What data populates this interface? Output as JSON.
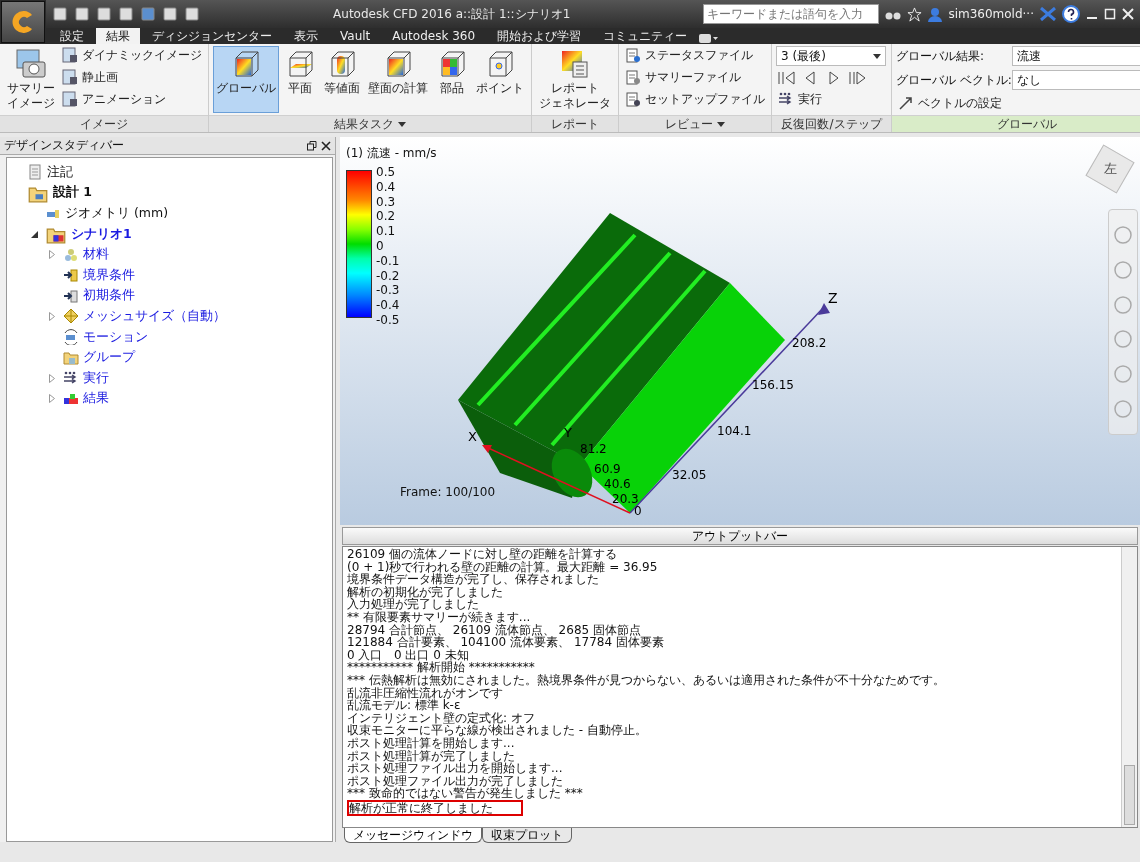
{
  "title_bar": {
    "title": "Autodesk CFD 2016   a::設計 1::シナリオ1",
    "search": {
      "placeholder": "キーワードまたは語句を入力"
    },
    "user": "sim360mold···"
  },
  "menu_tabs": [
    {
      "label": "設定",
      "selected": false
    },
    {
      "label": "結果",
      "selected": true
    },
    {
      "label": "ディシジョンセンター",
      "selected": false
    },
    {
      "label": "表示",
      "selected": false
    },
    {
      "label": "Vault",
      "selected": false
    },
    {
      "label": "Autodesk 360",
      "selected": false
    },
    {
      "label": "開始および学習",
      "selected": false
    },
    {
      "label": "コミュニティー",
      "selected": false
    }
  ],
  "ribbon": {
    "image_group": {
      "title": "イメージ",
      "big_button": [
        "サマリー",
        "イメージ"
      ],
      "small_buttons": [
        "ダイナミックイメージ",
        "静止画",
        "アニメーション"
      ]
    },
    "results_group": {
      "title": "結果タスク",
      "tools": [
        {
          "label": "グローバル",
          "selected": true
        },
        {
          "label": "平面",
          "selected": false
        },
        {
          "label": "等値面",
          "selected": false
        },
        {
          "label": "壁面の計算",
          "selected": false
        },
        {
          "label": "部品",
          "selected": false
        },
        {
          "label": "ポイント",
          "selected": false
        }
      ]
    },
    "report_group": {
      "title": "レポート",
      "button": [
        "レポート",
        "ジェネレータ"
      ]
    },
    "review_group": {
      "title": "レビュー",
      "items": [
        "ステータスファイル",
        "サマリーファイル",
        "セットアップファイル"
      ]
    },
    "iteration_group": {
      "title": "反復回数/ステップ",
      "step": "3 (最後)",
      "run": "実行"
    },
    "global_group": {
      "title": "グローバル",
      "rows": [
        {
          "label": "グローバル結果:",
          "value": "流速"
        },
        {
          "label": "グローバル ベクトル:",
          "value": "なし"
        }
      ],
      "vector_button": "ベクトルの設定"
    }
  },
  "design_bar": {
    "title": "デザインスタディバー",
    "tree": [
      {
        "label": "注記",
        "kind": "note"
      },
      {
        "label": "設計 1",
        "kind": "design",
        "children": [
          {
            "label": "ジオメトリ (mm)",
            "kind": "geometry"
          },
          {
            "label": "シナリオ1",
            "kind": "scenario",
            "expanded": true,
            "children": [
              {
                "label": "材料",
                "kind": "material",
                "expanded": false
              },
              {
                "label": "境界条件",
                "kind": "boundary"
              },
              {
                "label": "初期条件",
                "kind": "initial"
              },
              {
                "label": "メッシュサイズ（自動）",
                "kind": "mesh",
                "expanded": false
              },
              {
                "label": "モーション",
                "kind": "motion"
              },
              {
                "label": "グループ",
                "kind": "group"
              },
              {
                "label": "実行",
                "kind": "run",
                "expanded": false
              },
              {
                "label": "結果",
                "kind": "results",
                "expanded": false
              }
            ]
          }
        ]
      }
    ]
  },
  "viewport": {
    "result_title": "(1) 流速 - mm/s",
    "legend": [
      "0.5",
      "0.4",
      "0.3",
      "0.2",
      "0.1",
      "0",
      "-0.1",
      "-0.2",
      "-0.3",
      "-0.4",
      "-0.5"
    ],
    "frame": "Frame: 100/100",
    "viewcube_face": "左",
    "axes": {
      "x": "X",
      "y": "Y",
      "z": "Z",
      "z_ticks": [
        "208.2",
        "156.15",
        "104.1",
        "32.05"
      ],
      "y_ticks": [
        "81.2",
        "60.9",
        "40.6",
        "20.3",
        "0"
      ]
    }
  },
  "output": {
    "bar_button": "アウトプットバー",
    "lines": [
      {
        "text": "26109 個の流体ノードに対し壁の距離を計算する",
        "highlighted": false
      },
      {
        "text": "(0 + 1)秒で行われる壁の距離の計算。最大距離 = 36.95",
        "highlighted": false
      },
      {
        "text": "境界条件データ構造が完了し、保存されました",
        "highlighted": false
      },
      {
        "text": "解析の初期化が完了しました",
        "highlighted": false
      },
      {
        "text": "入力処理が完了しました",
        "highlighted": false
      },
      {
        "text": "** 有限要素サマリーが続きます...",
        "highlighted": false
      },
      {
        "text": "28794 合計節点、 26109 流体節点、 2685 固体節点",
        "highlighted": false
      },
      {
        "text": "121884 合計要素、 104100 流体要素、 17784 固体要素",
        "highlighted": false
      },
      {
        "text": "0 入口   0 出口 0 未知",
        "highlighted": false
      },
      {
        "text": "*********** 解析開始 ***********",
        "highlighted": false
      },
      {
        "text": "*** 伝熱解析は無効にされました。熱境界条件が見つからない、あるいは適用された条件が不十分なためです。",
        "highlighted": false
      },
      {
        "text": "乱流非圧縮性流れがオンです",
        "highlighted": false
      },
      {
        "text": "乱流モデル: 標準 k-ε",
        "highlighted": false
      },
      {
        "text": "インテリジェント壁の定式化: オフ",
        "highlighted": false
      },
      {
        "text": "収束モニターに平らな線が検出されました - 自動停止。",
        "highlighted": false
      },
      {
        "text": "ポスト処理計算を開始します...",
        "highlighted": false
      },
      {
        "text": "ポスト処理計算が完了しました",
        "highlighted": false
      },
      {
        "text": "ポスト処理ファイル出力を開始します...",
        "highlighted": false
      },
      {
        "text": "ポスト処理ファイル出力が完了しました",
        "highlighted": false
      },
      {
        "text": "*** 致命的ではない警告が発生しました ***",
        "highlighted": false
      },
      {
        "text": "解析が正常に終了しました",
        "highlighted": true
      }
    ],
    "tabs": [
      {
        "label": "メッセージウィンドウ",
        "selected": true
      },
      {
        "label": "収束プロット",
        "selected": false
      }
    ]
  }
}
